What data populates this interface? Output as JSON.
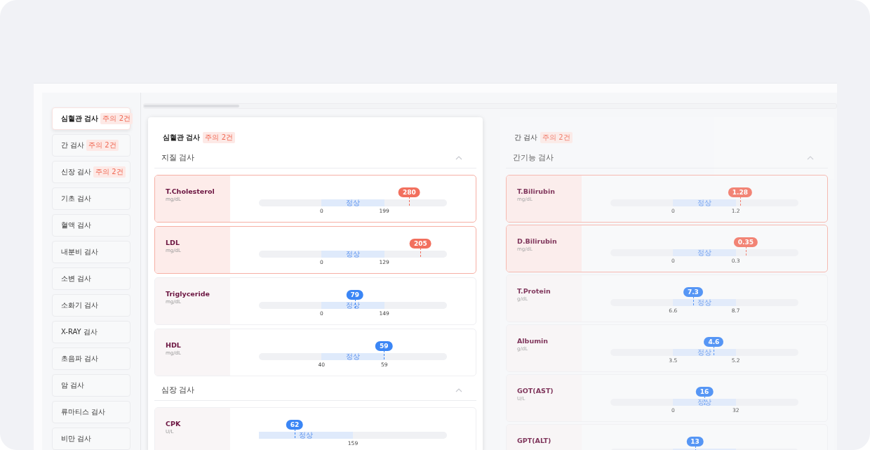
{
  "sidebar": {
    "items": [
      {
        "label": "심혈관 검사",
        "badge": "주의 2건",
        "selected": true
      },
      {
        "label": "간 검사",
        "badge": "주의 2건",
        "selected": false
      },
      {
        "label": "신장 검사",
        "badge": "주의 2건",
        "selected": false
      },
      {
        "label": "기초 검사",
        "selected": false
      },
      {
        "label": "혈액 검사",
        "selected": false
      },
      {
        "label": "내분비 검사",
        "selected": false
      },
      {
        "label": "소변 검사",
        "selected": false
      },
      {
        "label": "소화기 검사",
        "selected": false
      },
      {
        "label": "X-RAY 검사",
        "selected": false
      },
      {
        "label": "초음파 검사",
        "selected": false
      },
      {
        "label": "암 검사",
        "selected": false
      },
      {
        "label": "류마티스 검사",
        "selected": false
      },
      {
        "label": "비만 검사",
        "selected": false
      }
    ]
  },
  "panels": [
    {
      "title": "심혈관 검사",
      "badge": "주의 2건",
      "selected": true,
      "sections": [
        {
          "title": "지질 검사",
          "expanded": true,
          "tests": [
            {
              "name": "T.Cholesterol",
              "unit": "mg/dL",
              "value": "280",
              "level": 0.8,
              "alert": true,
              "kind": "middle",
              "band_label": "정상",
              "low": "0",
              "high": "199"
            },
            {
              "name": "LDL",
              "unit": "mg/dL",
              "value": "205",
              "level": 0.86,
              "alert": true,
              "kind": "middle",
              "band_label": "정상",
              "low": "0",
              "high": "129"
            },
            {
              "name": "Triglyceride",
              "unit": "mg/dL",
              "value": "79",
              "level": 0.51,
              "alert": false,
              "kind": "middle",
              "band_label": "정상",
              "low": "0",
              "high": "149"
            },
            {
              "name": "HDL",
              "unit": "mg/dL",
              "value": "59",
              "level": 0.665,
              "alert": false,
              "kind": "middle",
              "band_label": "정상",
              "low": "40",
              "high": "59"
            }
          ]
        },
        {
          "title": "심장 검사",
          "expanded": true,
          "tests": [
            {
              "name": "CPK",
              "unit": "U/L",
              "value": "62",
              "level": 0.19,
              "alert": false,
              "kind": "lower",
              "band_label": "정상",
              "high": "159"
            }
          ]
        }
      ]
    },
    {
      "title": "간 검사",
      "badge": "주의 2건",
      "selected": false,
      "sections": [
        {
          "title": "간기능 검사",
          "expanded": true,
          "tests": [
            {
              "name": "T.Bilirubin",
              "unit": "mg/dL",
              "value": "1.28",
              "level": 0.69,
              "alert": true,
              "kind": "middle",
              "band_label": "정상",
              "low": "0",
              "high": "1.2"
            },
            {
              "name": "D.Bilirubin",
              "unit": "mg/dL",
              "value": "0.35",
              "level": 0.72,
              "alert": true,
              "kind": "middle",
              "band_label": "정상",
              "low": "0",
              "high": "0.3"
            },
            {
              "name": "T.Protein",
              "unit": "g/dL",
              "value": "7.3",
              "level": 0.44,
              "alert": false,
              "kind": "middle",
              "band_label": "정상",
              "low": "6.6",
              "high": "8.7"
            },
            {
              "name": "Albumin",
              "unit": "g/dL",
              "value": "4.6",
              "level": 0.55,
              "alert": false,
              "kind": "middle",
              "band_label": "정상",
              "low": "3.5",
              "high": "5.2"
            },
            {
              "name": "GOT(AST)",
              "unit": "U/L",
              "value": "16",
              "level": 0.5,
              "alert": false,
              "kind": "middle",
              "band_label": "정상",
              "low": "0",
              "high": "32"
            },
            {
              "name": "GPT(ALT)",
              "value": "13",
              "level": 0.45,
              "alert": false,
              "kind": "middle"
            }
          ]
        }
      ]
    }
  ]
}
